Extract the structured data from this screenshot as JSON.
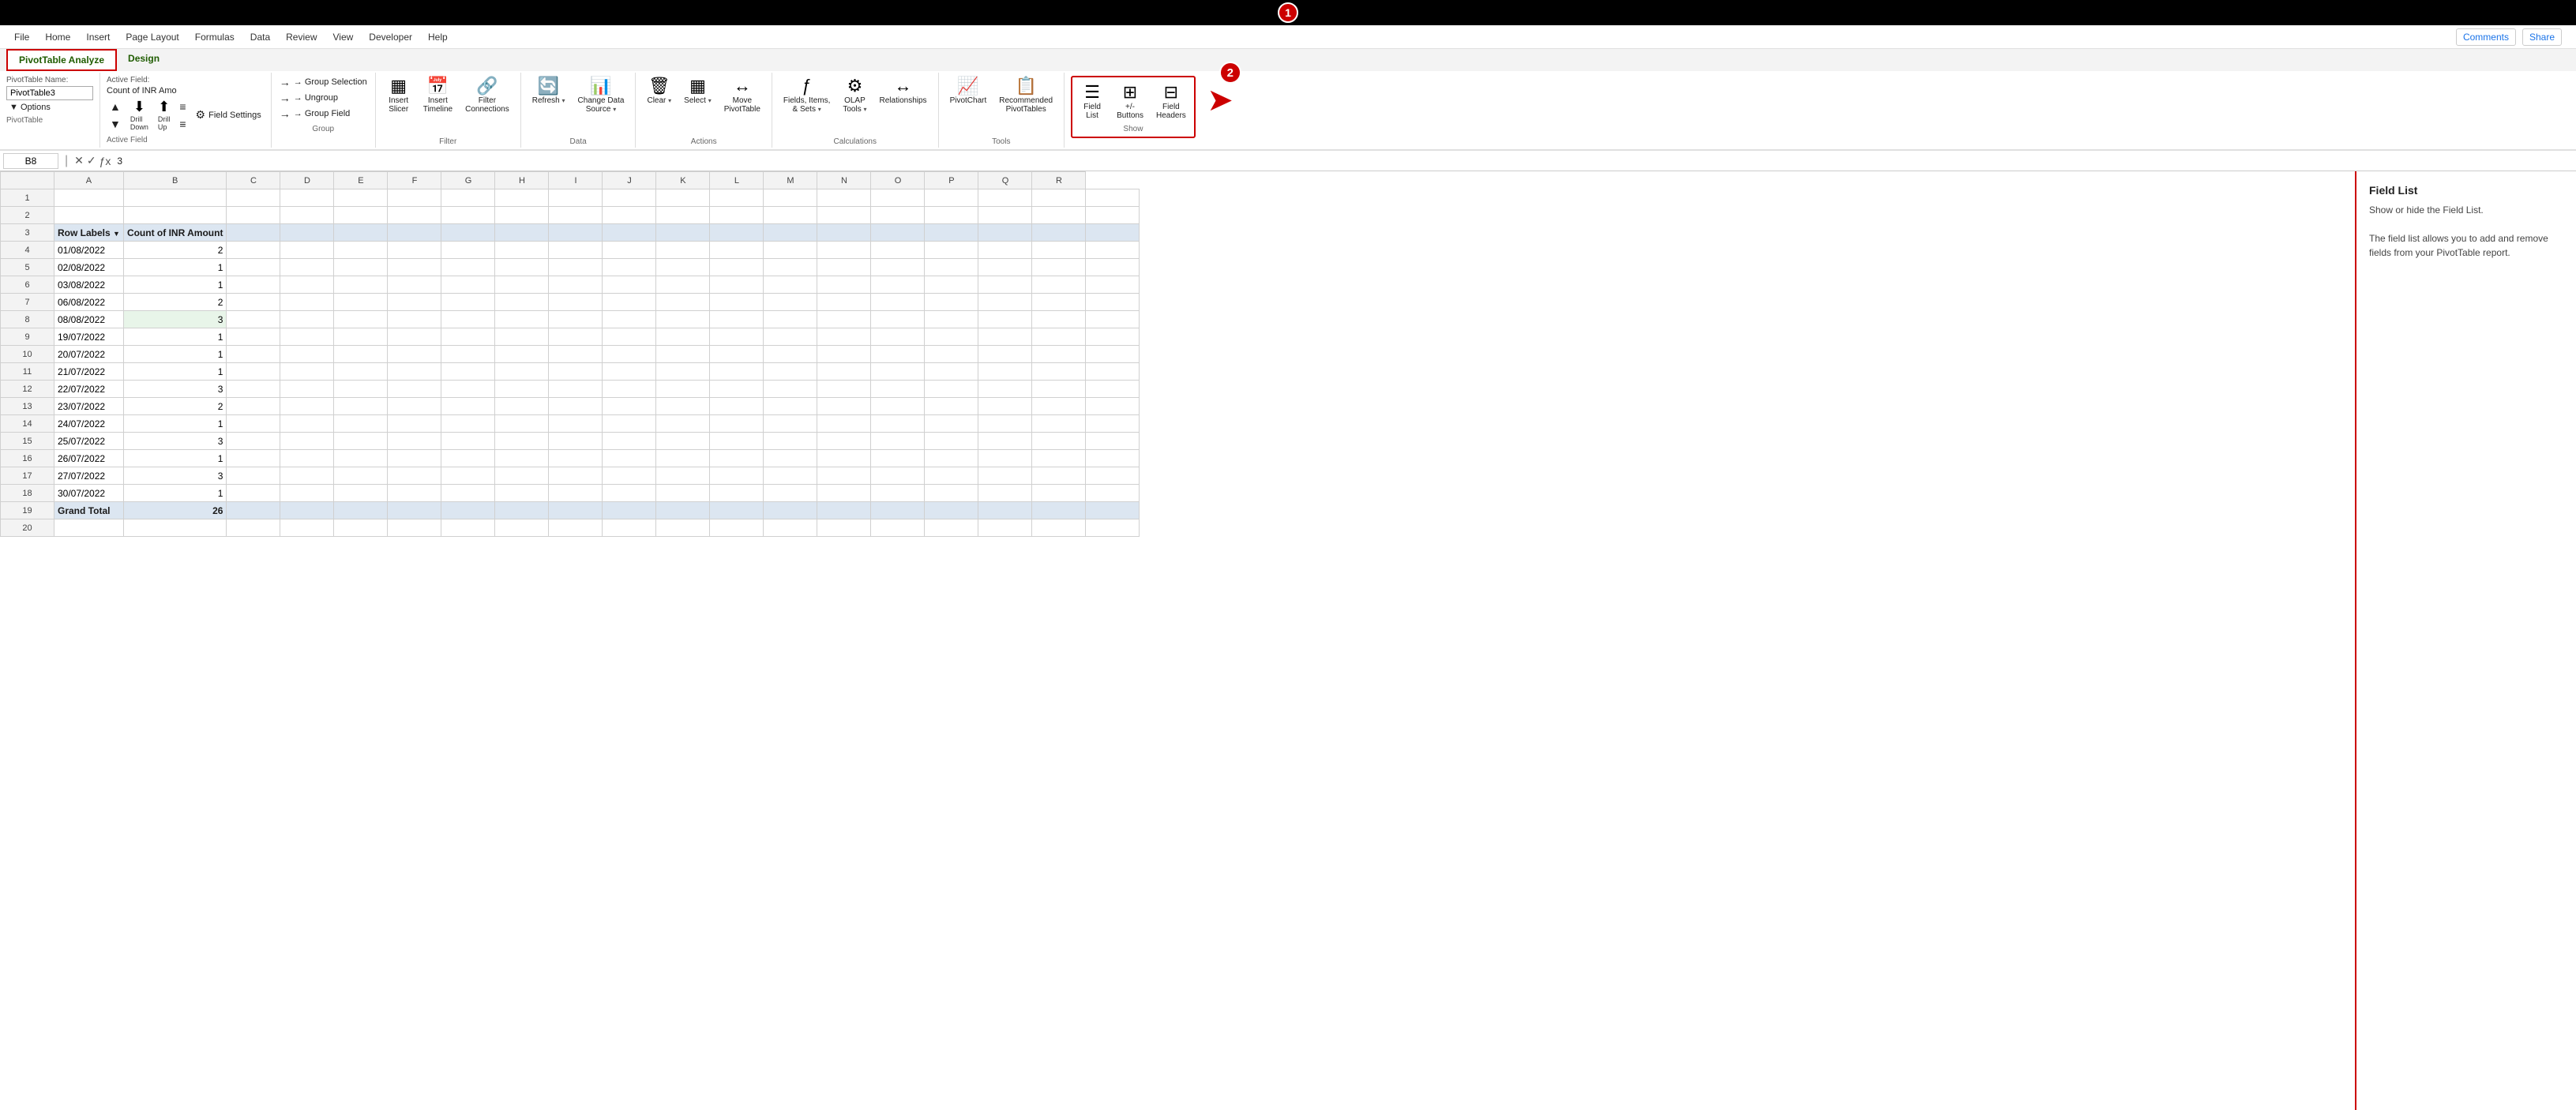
{
  "title_badge": "1",
  "second_badge": "2",
  "menu": {
    "items": [
      "File",
      "Home",
      "Insert",
      "Page Layout",
      "Formulas",
      "Data",
      "Review",
      "View",
      "Developer",
      "Help"
    ]
  },
  "tabs": [
    {
      "label": "PivotTable Analyze",
      "active": true,
      "highlighted": true
    },
    {
      "label": "Design",
      "active": false
    }
  ],
  "top_right": {
    "comments": "Comments",
    "share": "Share"
  },
  "pivottable_name": {
    "label": "PivotTable Name:",
    "value": "PivotTable3",
    "options_label": "▼ Options"
  },
  "active_field": {
    "label": "Active Field:",
    "value": "Count of INR Amo",
    "field_settings": "Field Settings"
  },
  "drill_buttons": {
    "drill_down": "Drill\nDown",
    "drill_up": "Drill\nUp"
  },
  "group_section": {
    "group_selection": "→ Group Selection",
    "ungroup": "→ Ungroup",
    "group_field": "→ Group Field",
    "label": "Group"
  },
  "filter_section": {
    "insert_slicer": "Insert\nSlicer",
    "insert_timeline": "Insert\nTimeline",
    "filter_connections": "Filter\nConnections",
    "label": "Filter"
  },
  "data_section": {
    "refresh": "Refresh",
    "change_data_source": "Change Data\nSource",
    "label": "Data"
  },
  "actions_section": {
    "clear": "Clear",
    "select": "Select",
    "move_pivottable": "Move\nPivotTable",
    "label": "Actions"
  },
  "calculations_section": {
    "fields_items_sets": "Fields, Items,\n& Sets",
    "olap_tools": "OLAP\nTools",
    "relationships": "Relationships",
    "label": "Calculations"
  },
  "tools_section": {
    "pivotchart": "PivotChart",
    "recommended": "Recommended\nPivotTables",
    "label": "Tools"
  },
  "show_section": {
    "field_list": "Field\nList",
    "buttons": "+/-\nButtons",
    "field_headers": "Field\nHeaders",
    "label": "Show"
  },
  "formula_bar": {
    "cell_ref": "B8",
    "value": "3"
  },
  "columns": [
    "",
    "A",
    "B",
    "C",
    "D",
    "E",
    "F",
    "G",
    "H",
    "I",
    "J",
    "K",
    "L",
    "M",
    "N",
    "O",
    "P",
    "Q",
    "R"
  ],
  "rows": [
    {
      "num": "1",
      "cells": {
        "a": "",
        "b": "",
        "rest": []
      }
    },
    {
      "num": "2",
      "cells": {
        "a": "",
        "b": "",
        "rest": []
      }
    },
    {
      "num": "3",
      "cells": {
        "a": "Row Labels",
        "b": "Count of INR Amount",
        "rest": []
      },
      "type": "header"
    },
    {
      "num": "4",
      "cells": {
        "a": "01/08/2022",
        "b": "2",
        "rest": []
      }
    },
    {
      "num": "5",
      "cells": {
        "a": "02/08/2022",
        "b": "1",
        "rest": []
      }
    },
    {
      "num": "6",
      "cells": {
        "a": "03/08/2022",
        "b": "1",
        "rest": []
      }
    },
    {
      "num": "7",
      "cells": {
        "a": "06/08/2022",
        "b": "2",
        "rest": []
      }
    },
    {
      "num": "8",
      "cells": {
        "a": "08/08/2022",
        "b": "3",
        "rest": []
      },
      "active": true
    },
    {
      "num": "9",
      "cells": {
        "a": "19/07/2022",
        "b": "1",
        "rest": []
      }
    },
    {
      "num": "10",
      "cells": {
        "a": "20/07/2022",
        "b": "1",
        "rest": []
      }
    },
    {
      "num": "11",
      "cells": {
        "a": "21/07/2022",
        "b": "1",
        "rest": []
      }
    },
    {
      "num": "12",
      "cells": {
        "a": "22/07/2022",
        "b": "3",
        "rest": []
      }
    },
    {
      "num": "13",
      "cells": {
        "a": "23/07/2022",
        "b": "2",
        "rest": []
      }
    },
    {
      "num": "14",
      "cells": {
        "a": "24/07/2022",
        "b": "1",
        "rest": []
      }
    },
    {
      "num": "15",
      "cells": {
        "a": "25/07/2022",
        "b": "3",
        "rest": []
      }
    },
    {
      "num": "16",
      "cells": {
        "a": "26/07/2022",
        "b": "1",
        "rest": []
      }
    },
    {
      "num": "17",
      "cells": {
        "a": "27/07/2022",
        "b": "3",
        "rest": []
      }
    },
    {
      "num": "18",
      "cells": {
        "a": "30/07/2022",
        "b": "1",
        "rest": []
      }
    },
    {
      "num": "19",
      "cells": {
        "a": "Grand Total",
        "b": "26",
        "rest": []
      },
      "type": "grand-total"
    },
    {
      "num": "20",
      "cells": {
        "a": "",
        "b": "",
        "rest": []
      }
    }
  ],
  "field_list_panel": {
    "title": "Field List",
    "desc_line1": "Show or hide the Field List.",
    "desc_line2": "",
    "desc_line3": "The field list allows you to add and remove fields from your PivotTable report."
  }
}
